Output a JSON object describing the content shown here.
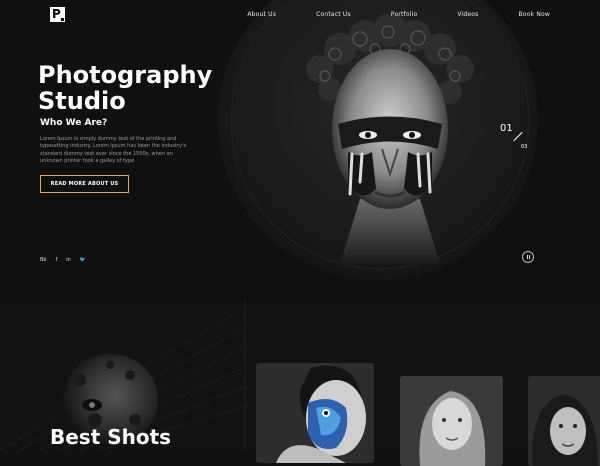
{
  "brand": {
    "logo_letter": "P"
  },
  "nav": {
    "items": [
      "About Us",
      "Contact Us",
      "Portfolio",
      "Videos",
      "Book Now"
    ]
  },
  "hero": {
    "title_line1": "Photography",
    "title_line2": "Studio",
    "subtitle": "Who We Are?",
    "description": "Lorem Ipsum is simply dummy text of the printing and typesetting industry. Lorem Ipsum has been the industry's standard dummy text ever since the 1500s, when an unknown printer took a galley of type",
    "cta_label": "READ MORE ABOUT US",
    "slide_current": "01",
    "slide_total": "03",
    "accent_color": "#f0a93b"
  },
  "social": {
    "items": [
      {
        "icon": "behance-icon",
        "glyph": "Bē"
      },
      {
        "icon": "facebook-icon",
        "glyph": "f"
      },
      {
        "icon": "linkedin-icon",
        "glyph": "in"
      },
      {
        "icon": "twitter-icon",
        "glyph": "🐦"
      }
    ]
  },
  "gallery": {
    "heading": "Best Shots"
  }
}
